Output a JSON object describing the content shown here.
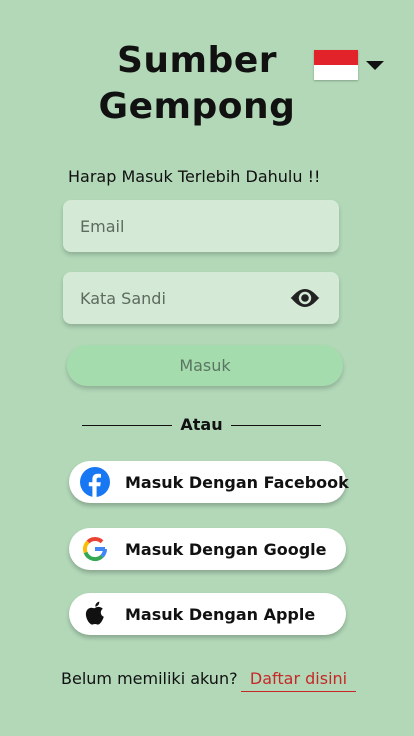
{
  "app": {
    "title_line1": "Sumber",
    "title_line2": "Gempong"
  },
  "language": {
    "flag_icon": "indonesia-flag-icon",
    "flag_colors": [
      "#e2232a",
      "#ffffff"
    ]
  },
  "login": {
    "prompt": "Harap Masuk Terlebih Dahulu !!",
    "email_placeholder": "Email",
    "password_placeholder": "Kata Sandi",
    "submit_label": "Masuk"
  },
  "separator": {
    "label": "Atau"
  },
  "social_logins": {
    "facebook_label": "Masuk Dengan Facebook",
    "google_label": "Masuk Dengan Google",
    "apple_label": "Masuk Dengan Apple"
  },
  "footer": {
    "question": "Belum memiliki akun?",
    "register_link": "Daftar disini"
  },
  "colors": {
    "background": "#b2d8b8",
    "field": "#d4ead6",
    "submit": "#a4dcae",
    "link": "#c62828",
    "facebook": "#1877f2"
  }
}
